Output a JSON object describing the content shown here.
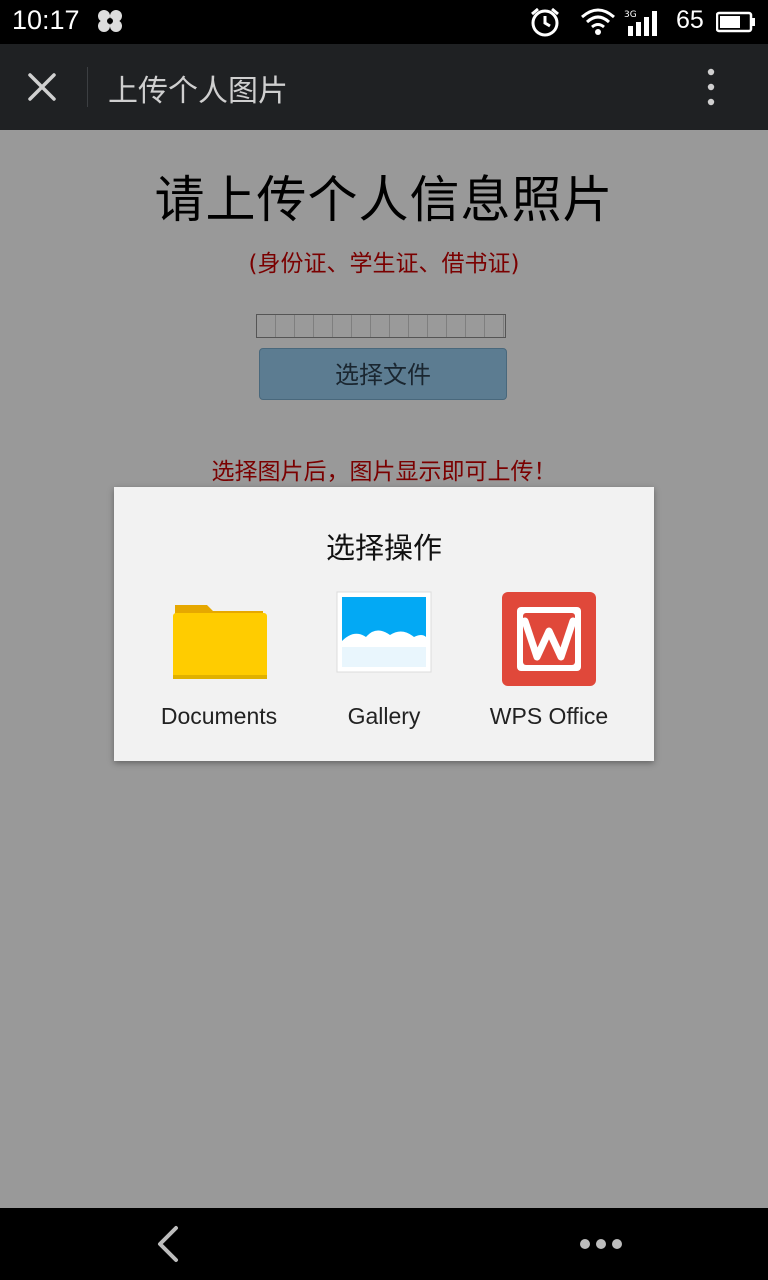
{
  "status_bar": {
    "time": "10:17",
    "battery_level": "65",
    "network_label": "3G",
    "icons": [
      "clover-icon",
      "alarm-icon",
      "wifi-icon",
      "signal-icon",
      "battery-icon"
    ]
  },
  "header": {
    "title": "上传个人图片",
    "close_icon": "close-icon",
    "menu_icon": "more-vertical-icon"
  },
  "page": {
    "heading": "请上传个人信息照片",
    "subheading": "(身份证、学生证、借书证)",
    "choose_file_label": "选择文件",
    "hint": "选择图片后，图片显示即可上传！"
  },
  "dialog": {
    "title": "选择操作",
    "options": [
      {
        "label": "Documents",
        "icon": "folder-icon"
      },
      {
        "label": "Gallery",
        "icon": "gallery-icon"
      },
      {
        "label": "WPS Office",
        "icon": "wps-office-icon"
      }
    ]
  },
  "bottom_nav": {
    "back_icon": "back-arrow-icon",
    "more_icon": "more-dots-icon"
  },
  "colors": {
    "overlay": "#999999",
    "header_bg": "#1f2123",
    "accent_red": "#7a0000",
    "folder_yellow": "#ffcc00",
    "gallery_blue": "#03a9f4",
    "wps_red": "#e0483a"
  }
}
